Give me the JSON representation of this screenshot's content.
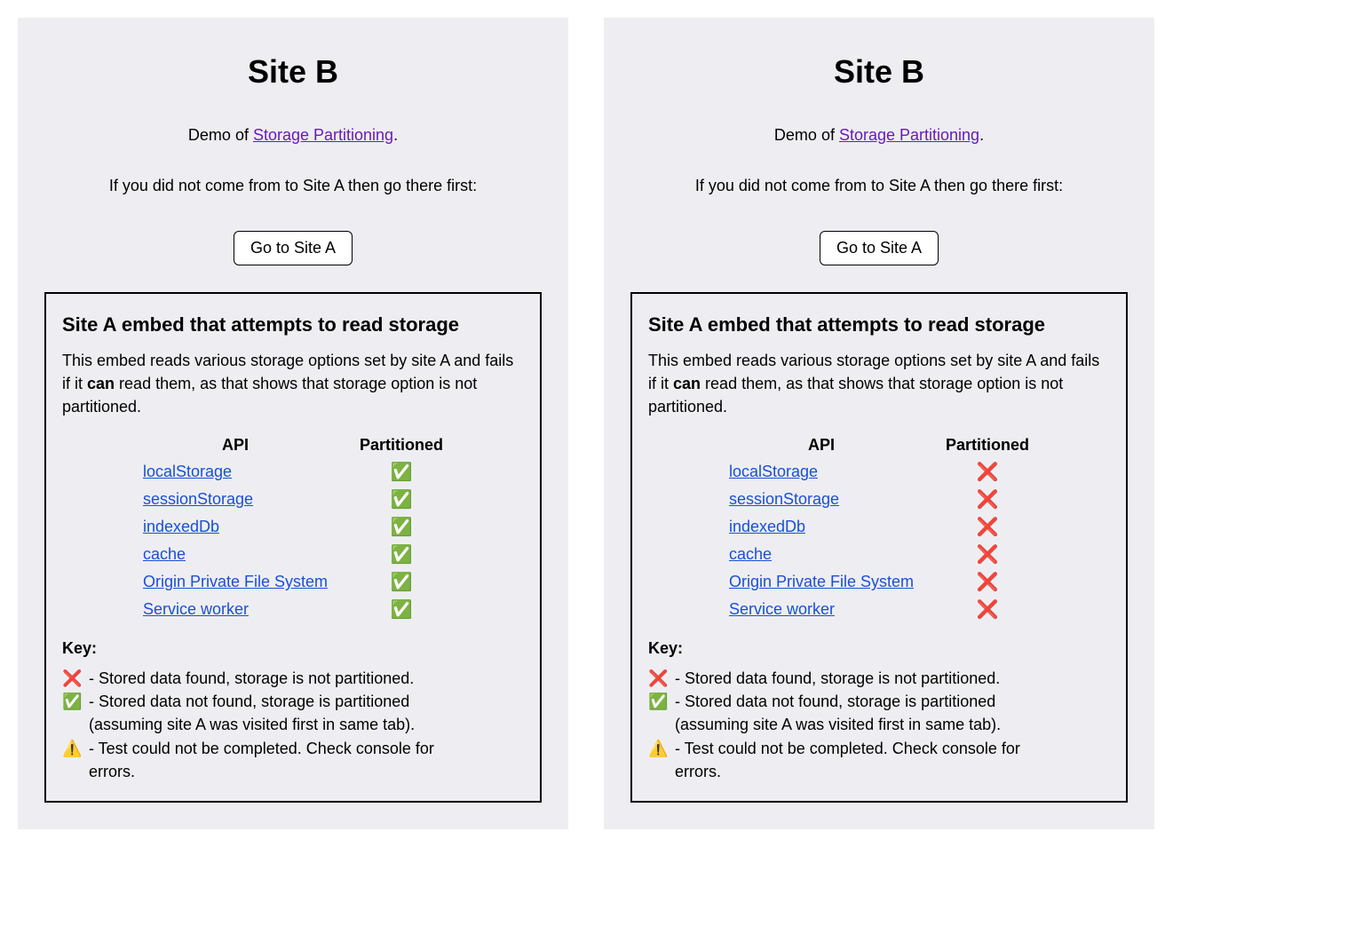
{
  "title": "Site B",
  "demo_prefix": "Demo of ",
  "demo_link": "Storage Partitioning",
  "demo_suffix": ".",
  "instruction": "If you did not come from to Site A then go there first:",
  "goto_label": "Go to Site A",
  "embed_heading": "Site A embed that attempts to read storage",
  "embed_desc_1": "This embed reads various storage options set by site A and fails if it ",
  "embed_desc_can": "can",
  "embed_desc_2": " read them, as that shows that storage option is not partitioned.",
  "table": {
    "col_api": "API",
    "col_part": "Partitioned",
    "rows": [
      {
        "api": "localStorage"
      },
      {
        "api": "sessionStorage"
      },
      {
        "api": "indexedDb"
      },
      {
        "api": "cache"
      },
      {
        "api": "Origin Private File System"
      },
      {
        "api": "Service worker"
      }
    ]
  },
  "icons": {
    "pass": "✅",
    "fail": "❌",
    "warn": "⚠️"
  },
  "key_heading": "Key:",
  "key": {
    "fail": "- Stored data found, storage is not partitioned.",
    "pass1": "- Stored data not found, storage is partitioned",
    "pass2": "(assuming site A was visited first in same tab).",
    "warn1": "- Test could not be completed. Check console for",
    "warn2": "errors."
  },
  "panels": [
    {
      "results": [
        "pass",
        "pass",
        "pass",
        "pass",
        "pass",
        "pass"
      ]
    },
    {
      "results": [
        "fail",
        "fail",
        "fail",
        "fail",
        "fail",
        "fail"
      ]
    }
  ]
}
